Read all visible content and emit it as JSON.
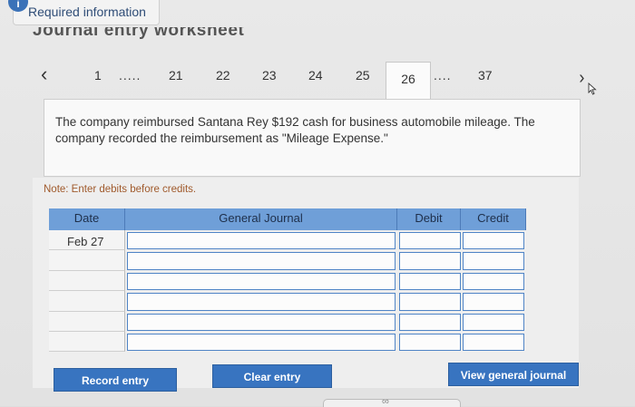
{
  "header": {
    "badge": "i",
    "required_label": "Required information",
    "worksheet_title": "Journal entry worksheet"
  },
  "nav": {
    "prev_icon": "chevron-left-icon",
    "items": [
      "1",
      ".....",
      "21",
      "22",
      "23",
      "24",
      "25",
      "26",
      "....",
      "37"
    ],
    "active": "26",
    "next_icon": "chevron-right-icon"
  },
  "description": "The company reimbursed Santana Rey $192 cash for business automobile mileage. The company recorded the reimbursement as \"Mileage Expense.\"",
  "note": "Note: Enter debits before credits.",
  "table": {
    "headers": {
      "date": "Date",
      "journal": "General Journal",
      "debit": "Debit",
      "credit": "Credit"
    },
    "rows": [
      {
        "date": "Feb 27",
        "journal": "",
        "debit": "",
        "credit": ""
      },
      {
        "date": "",
        "journal": "",
        "debit": "",
        "credit": ""
      },
      {
        "date": "",
        "journal": "",
        "debit": "",
        "credit": ""
      },
      {
        "date": "",
        "journal": "",
        "debit": "",
        "credit": ""
      },
      {
        "date": "",
        "journal": "",
        "debit": "",
        "credit": ""
      },
      {
        "date": "",
        "journal": "",
        "debit": "",
        "credit": ""
      }
    ]
  },
  "buttons": {
    "record": "Record entry",
    "clear": "Clear entry",
    "view": "View general journal"
  },
  "colors": {
    "header_blue": "#6f9fd8",
    "button_blue": "#3874c0",
    "note_text": "#a05a2c"
  }
}
